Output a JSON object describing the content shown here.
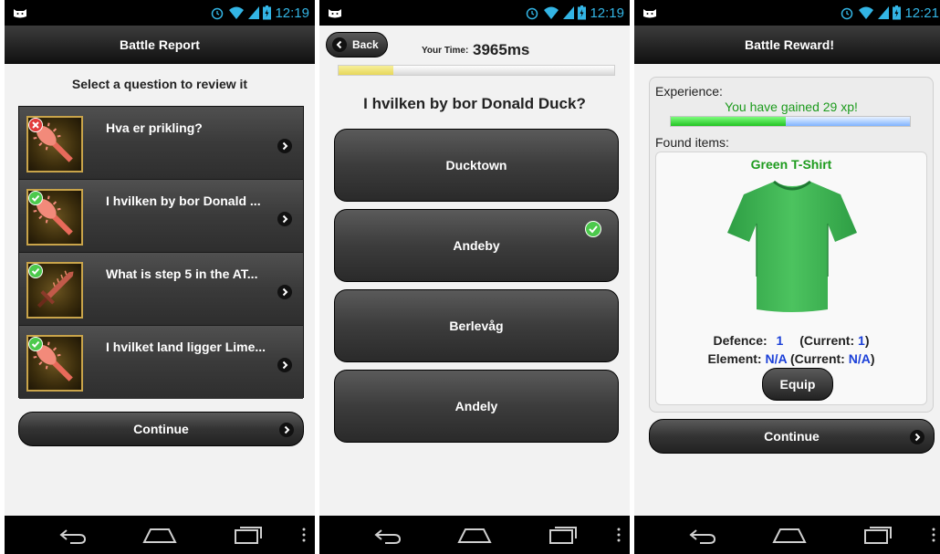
{
  "status_bar": {
    "time_1": "12:19",
    "time_2": "12:19",
    "time_3": "12:21"
  },
  "battle_report": {
    "header": "Battle Report",
    "prompt": "Select a question to review it",
    "questions": [
      {
        "text": "Hva er prikling?",
        "result": "wrong",
        "icon": "spiked-club-icon"
      },
      {
        "text": "I hvilken by bor Donald ...",
        "result": "correct",
        "icon": "spiked-club-icon"
      },
      {
        "text": "What is step 5 in the AT...",
        "result": "correct",
        "icon": "sword-icon"
      },
      {
        "text": "I hvilket land ligger Lime...",
        "result": "correct",
        "icon": "spiked-club-icon"
      }
    ],
    "continue_label": "Continue"
  },
  "question_review": {
    "back_label": "Back",
    "time_label": "Your Time:",
    "time_value": "3965ms",
    "time_fraction": 0.2,
    "question": "I hvilken by bor Donald Duck?",
    "answers": [
      {
        "label": "Ducktown",
        "correct": false
      },
      {
        "label": "Andeby",
        "correct": true
      },
      {
        "label": "Berlevåg",
        "correct": false
      },
      {
        "label": "Andely",
        "correct": false
      }
    ]
  },
  "battle_reward": {
    "header": "Battle Reward!",
    "experience_label": "Experience:",
    "xp_message": "You have gained 29 xp!",
    "xp_fraction": 0.48,
    "found_items_label": "Found items:",
    "item_name": "Green T-Shirt",
    "defence_label": "Defence:",
    "defence_value": "1",
    "defence_current_label": "(Current:",
    "defence_current_value": "1",
    "element_label": "Element:",
    "element_value": "N/A",
    "element_current_label": "(Current:",
    "element_current_value": "N/A",
    "close_paren": ")",
    "equip_label": "Equip",
    "continue_label": "Continue",
    "colors": {
      "xp_text": "#1d9b1d",
      "stat_value": "#1a3fd8"
    }
  }
}
